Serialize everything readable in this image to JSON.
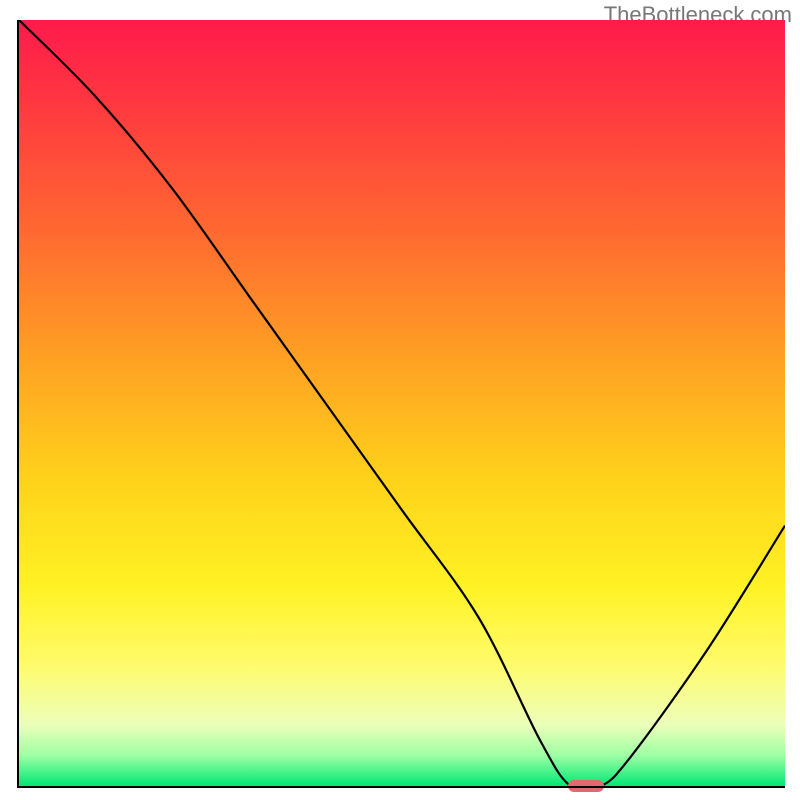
{
  "watermark": "TheBottleneck.com",
  "chart_data": {
    "type": "line",
    "title": "",
    "xlabel": "",
    "ylabel": "",
    "xlim": [
      0,
      100
    ],
    "ylim": [
      0,
      100
    ],
    "x": [
      0,
      10,
      20,
      30,
      40,
      50,
      60,
      68,
      72,
      76,
      80,
      90,
      100
    ],
    "y": [
      100,
      90,
      78,
      64,
      50,
      36,
      22,
      6,
      0,
      0,
      4,
      18,
      34
    ],
    "marker_x": 74,
    "background_gradient": {
      "top": "#ff1a4a",
      "mid_upper": "#ffa023",
      "mid_lower": "#fff224",
      "bottom": "#00e874"
    }
  }
}
